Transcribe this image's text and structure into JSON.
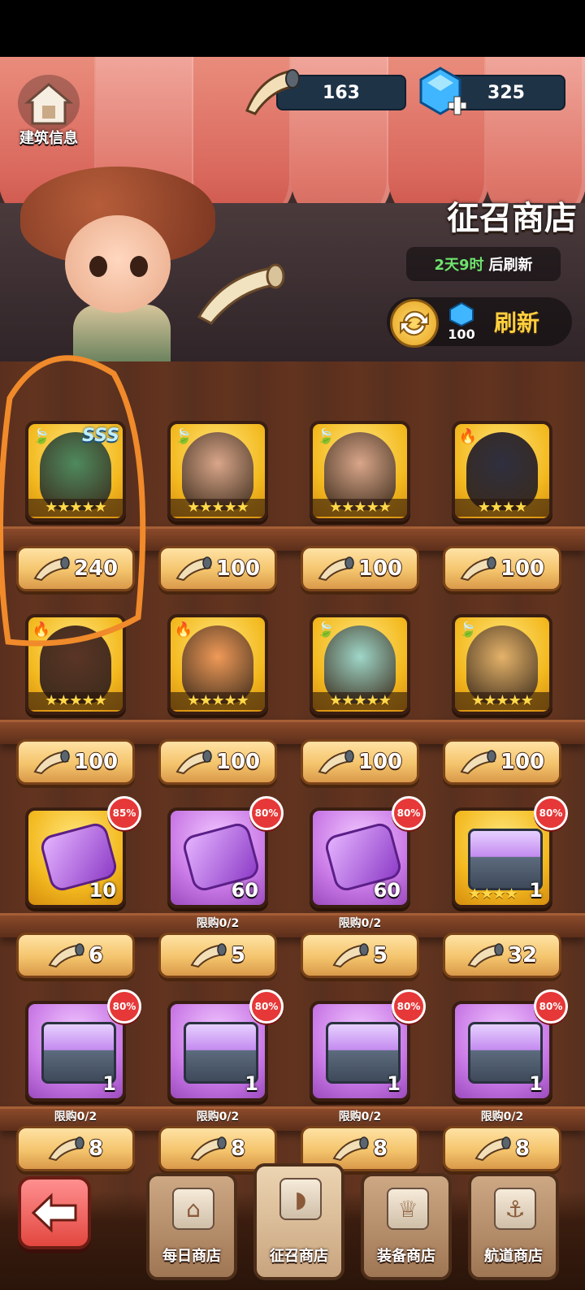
{
  "header": {
    "building_info_label": "建筑信息",
    "currencies": [
      {
        "icon": "horn-icon",
        "value": "163"
      },
      {
        "icon": "gem-plus-icon",
        "value": "325"
      }
    ],
    "shop_title": "征召商店",
    "refresh_countdown": {
      "time": "2天9时",
      "suffix": "后刷新"
    },
    "refresh_button": {
      "cost": "100",
      "label": "刷新"
    }
  },
  "colors": {
    "accent_gold": "#ffcf3e",
    "time_green": "#6ee36e",
    "discount_red": "#e63838",
    "highlight_orange": "#f08a2a"
  },
  "rows": [
    {
      "items": [
        {
          "type": "hero",
          "element": "leaf",
          "rarity_label": "SSS",
          "stars": "★★★★★",
          "price": "240",
          "portrait": "#4f8a5e"
        },
        {
          "type": "hero",
          "element": "leaf",
          "stars": "★★★★★",
          "price": "100",
          "portrait": "#d9a68a"
        },
        {
          "type": "hero",
          "element": "leaf",
          "stars": "★★★★★",
          "price": "100",
          "portrait": "#d9a68a"
        },
        {
          "type": "hero",
          "element": "fire",
          "stars": "★★★★",
          "price": "100",
          "portrait": "#2f2f3f"
        }
      ]
    },
    {
      "items": [
        {
          "type": "hero",
          "element": "fire",
          "stars": "★★★★★",
          "price": "100",
          "portrait": "#5a3526"
        },
        {
          "type": "hero",
          "element": "fire",
          "stars": "★★★★★",
          "price": "100",
          "portrait": "#f09a58"
        },
        {
          "type": "hero",
          "element": "leaf",
          "stars": "★★★★★",
          "price": "100",
          "portrait": "#9fd7c8"
        },
        {
          "type": "hero",
          "element": "leaf",
          "stars": "★★★★★",
          "price": "100",
          "portrait": "#e5b36a"
        }
      ]
    },
    {
      "items": [
        {
          "type": "piece",
          "frame": "gold",
          "discount": "85%",
          "qty": "10",
          "price": "6",
          "limit": ""
        },
        {
          "type": "piece",
          "frame": "purple",
          "discount": "80%",
          "qty": "60",
          "price": "5",
          "limit": "限购0/2"
        },
        {
          "type": "piece",
          "frame": "purple",
          "discount": "80%",
          "qty": "60",
          "price": "5",
          "limit": "限购0/2"
        },
        {
          "type": "chest",
          "frame": "gold",
          "discount": "80%",
          "qty": "1",
          "stars": "★★★★",
          "price": "32",
          "limit": ""
        }
      ]
    },
    {
      "items": [
        {
          "type": "chest",
          "frame": "purple",
          "discount": "80%",
          "qty": "1",
          "price": "8",
          "limit": "限购0/2"
        },
        {
          "type": "chest",
          "frame": "purple",
          "discount": "80%",
          "qty": "1",
          "price": "8",
          "limit": "限购0/2"
        },
        {
          "type": "chest",
          "frame": "purple",
          "discount": "80%",
          "qty": "1",
          "price": "8",
          "limit": "限购0/2"
        },
        {
          "type": "chest",
          "frame": "purple",
          "discount": "80%",
          "qty": "1",
          "price": "8",
          "limit": "限购0/2"
        }
      ]
    }
  ],
  "bottom_nav": {
    "back_icon": "back-arrow-icon",
    "tabs": [
      {
        "label": "每日商店",
        "icon": "store-icon",
        "active": false
      },
      {
        "label": "征召商店",
        "icon": "horn-icon",
        "active": true
      },
      {
        "label": "装备商店",
        "icon": "shirt-icon",
        "active": false
      },
      {
        "label": "航道商店",
        "icon": "anchor-icon",
        "active": false
      }
    ]
  }
}
